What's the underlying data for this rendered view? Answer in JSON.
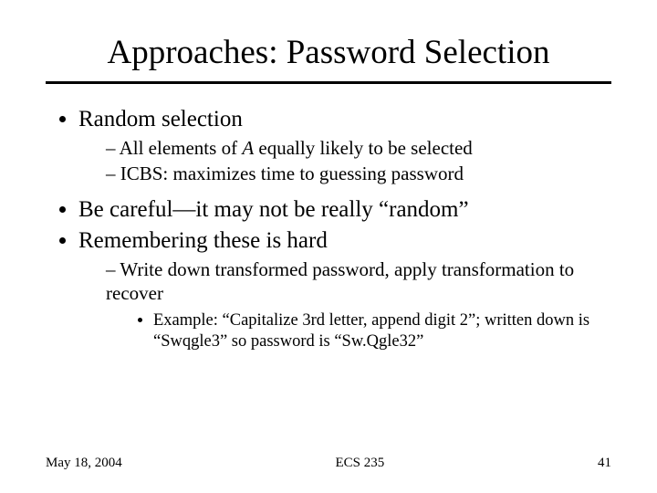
{
  "title": "Approaches: Password Selection",
  "bullets": {
    "b1": "Random selection",
    "b1_1_pre": "All elements of ",
    "b1_1_mid": "A",
    "b1_1_post": " equally likely to be selected",
    "b1_2": "ICBS: maximizes time to guessing password",
    "b2": "Be careful—it may not be really “random”",
    "b3": "Remembering these is hard",
    "b3_1": "Write down transformed password, apply transformation to recover",
    "b3_1_1": "Example: “Capitalize 3rd letter, append digit 2”; written down is “Swqgle3” so password is “Sw.Qgle32”"
  },
  "footer": {
    "date": "May 18, 2004",
    "course": "ECS 235",
    "page": "41"
  }
}
